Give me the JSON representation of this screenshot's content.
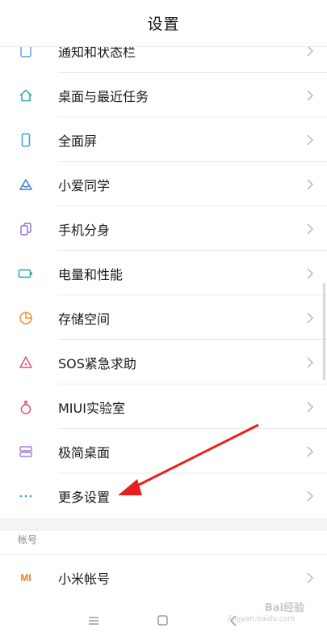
{
  "header": {
    "title": "设置"
  },
  "items": [
    {
      "label": "通知和状态栏",
      "icon": "notification-icon"
    },
    {
      "label": "桌面与最近任务",
      "icon": "home-icon"
    },
    {
      "label": "全面屏",
      "icon": "fullscreen-phone-icon"
    },
    {
      "label": "小爱同学",
      "icon": "xiaoai-icon"
    },
    {
      "label": "手机分身",
      "icon": "dual-phone-icon"
    },
    {
      "label": "电量和性能",
      "icon": "battery-icon"
    },
    {
      "label": "存储空间",
      "icon": "storage-pie-icon"
    },
    {
      "label": "SOS紧急求助",
      "icon": "sos-icon"
    },
    {
      "label": "MIUI实验室",
      "icon": "lab-flask-icon"
    },
    {
      "label": "极简桌面",
      "icon": "simple-desktop-icon"
    },
    {
      "label": "更多设置",
      "icon": "more-dots-icon"
    }
  ],
  "account_section": {
    "header": "帐号",
    "items": [
      {
        "label": "小米帐号",
        "icon": "mi-logo-icon",
        "icon_text": "MI"
      }
    ]
  },
  "colors": {
    "accent_teal": "#26a9a0",
    "mi_orange": "#f27a1a",
    "arrow_red": "#e8201d"
  },
  "watermark": {
    "line1": "Bai经验",
    "line2": "jingyan.baidu.com"
  }
}
